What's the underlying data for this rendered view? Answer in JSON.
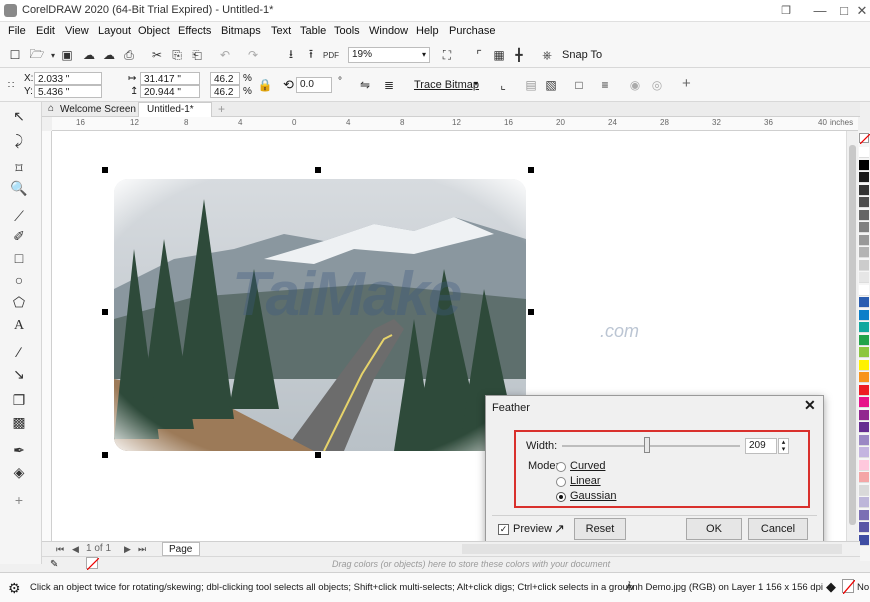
{
  "window": {
    "title": "CorelDRAW 2020 (64-Bit Trial Expired) - Untitled-1*",
    "controls": {
      "minimize": "—",
      "maximize": "□",
      "close": "✕"
    }
  },
  "menu": {
    "items": [
      "File",
      "Edit",
      "View",
      "Layout",
      "Object",
      "Effects",
      "Bitmaps",
      "Text",
      "Table",
      "Tools",
      "Window",
      "Help",
      "Purchase"
    ]
  },
  "standard_toolbar": {
    "zoom_value": "19%",
    "snap_to": "Snap To"
  },
  "property_bar": {
    "x": "2.033 \"",
    "y": "5.436 \"",
    "width": "31.417 \"",
    "height": "20.944 \"",
    "scale_w": "46.2",
    "scale_h": "46.2",
    "percent": "%",
    "rotation": "0.0",
    "degree": "°",
    "trace_bitmap": "Trace Bitmap",
    "plus": "+"
  },
  "tabs": {
    "welcome": "Welcome Screen",
    "document": "Untitled-1*",
    "add": "+"
  },
  "ruler": {
    "top_labels": [
      "16",
      "12",
      "8",
      "4",
      "0",
      "4",
      "8",
      "12",
      "16",
      "20",
      "24",
      "28",
      "32",
      "36",
      "40"
    ],
    "unit": "inches"
  },
  "watermark": {
    "text": "TaiMake",
    "suffix": ".com"
  },
  "dialog": {
    "title": "Feather",
    "width_label": "Width:",
    "width_value": "209",
    "mode_label": "Mode:",
    "modes": [
      {
        "label": "Curved",
        "selected": false
      },
      {
        "label": "Linear",
        "selected": false
      },
      {
        "label": "Gaussian",
        "selected": true
      }
    ],
    "preview_label": "Preview",
    "preview_checked": true,
    "reset": "Reset",
    "ok": "OK",
    "cancel": "Cancel",
    "close": "✕",
    "highlight_color": "#d9302c"
  },
  "pagebar": {
    "nav": "1 of 1",
    "page_tab": "Page 1"
  },
  "drawbar": {
    "hint": "Drag colors (or objects) here to store these colors with your document"
  },
  "status": {
    "message": "Click an object twice for rotating/skewing; dbl-clicking tool selects all objects; Shift+click multi-selects; Alt+click digs; Ctrl+click selects in a group",
    "object_info": "Ảnh Demo.jpg (RGB) on Layer 1 156 x 156 dpi",
    "fill": "No"
  },
  "palette_colors": [
    "#ffffff",
    "#000000",
    "#1a1a1a",
    "#333333",
    "#4d4d4d",
    "#666666",
    "#808080",
    "#999999",
    "#b3b3b3",
    "#cccccc",
    "#e6e6e6",
    "#ffffff",
    "#2a5db0",
    "#0b7fc9",
    "#13a89e",
    "#22a34a",
    "#8cc63f",
    "#fff200",
    "#f7941d",
    "#ed1c24",
    "#e7128a",
    "#92278f",
    "#662d91",
    "#9b88c4",
    "#c4b5e0",
    "#ffc8dd",
    "#f4a6a6",
    "#d9d9d9",
    "#bdb6d9",
    "#7b6fb4",
    "#5a57a6",
    "#3f4da3"
  ]
}
